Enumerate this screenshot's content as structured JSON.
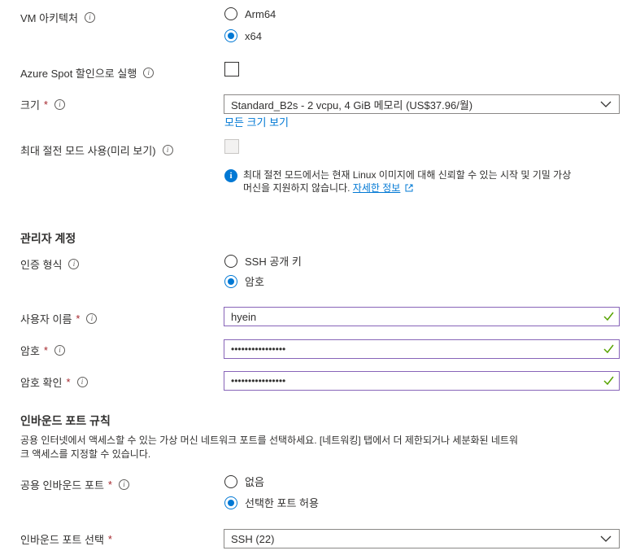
{
  "vm_arch": {
    "label": "VM 아키텍처",
    "options": [
      "Arm64",
      "x64"
    ],
    "selected": "x64"
  },
  "spot": {
    "label": "Azure Spot 할인으로 실행",
    "checked": false
  },
  "size": {
    "label": "크기",
    "value": "Standard_B2s - 2 vcpu, 4 GiB 메모리 (US$37.96/월)",
    "link": "모든 크기 보기"
  },
  "hibernate": {
    "label": "최대 절전 모드 사용(미리 보기)",
    "checked": false,
    "info_line1": "최대 절전 모드에서는 현재 Linux 이미지에 대해 신뢰할 수 있는 시작 및 기밀 가상",
    "info_line2": "머신을 지원하지 않습니다.",
    "info_link": "자세한 정보"
  },
  "admin": {
    "heading": "관리자 계정",
    "auth_label": "인증 형식",
    "auth_options": [
      "SSH 공개 키",
      "암호"
    ],
    "auth_selected": "암호",
    "username_label": "사용자 이름",
    "username_value": "hyein",
    "password_label": "암호",
    "password_value": "••••••••••••••••",
    "confirm_label": "암호 확인",
    "confirm_value": "••••••••••••••••"
  },
  "inbound": {
    "heading": "인바운드 포트 규칙",
    "description_line1": "공용 인터넷에서 액세스할 수 있는 가상 머신 네트워크 포트를 선택하세요. [네트워킹] 탭에서 더 제한되거나 세분화된 네트워",
    "description_line2": "크 액세스를 지정할 수 있습니다.",
    "public_label": "공용 인바운드 포트",
    "public_options": [
      "없음",
      "선택한 포트 허용"
    ],
    "public_selected": "선택한 포트 허용",
    "select_label": "인바운드 포트 선택",
    "select_value": "SSH (22)"
  },
  "required_mark": "*",
  "info_glyph": "i",
  "colors": {
    "accent": "#0078d4",
    "required": "#a4262c",
    "valid": "#57a300",
    "input_border": "#8764b8"
  }
}
